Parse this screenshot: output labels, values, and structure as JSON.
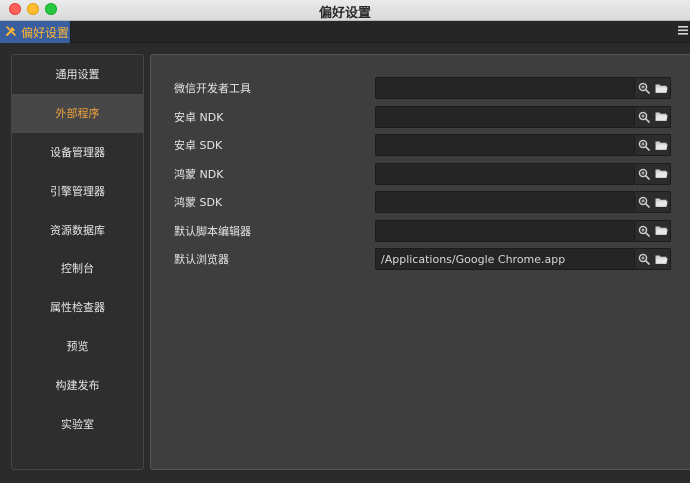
{
  "window": {
    "title": "偏好设置"
  },
  "tab": {
    "icon": "tools-icon",
    "label": "偏好设置"
  },
  "sidebar": {
    "items": [
      {
        "label": "通用设置",
        "active": false
      },
      {
        "label": "外部程序",
        "active": true
      },
      {
        "label": "设备管理器",
        "active": false
      },
      {
        "label": "引擎管理器",
        "active": false
      },
      {
        "label": "资源数据库",
        "active": false
      },
      {
        "label": "控制台",
        "active": false
      },
      {
        "label": "属性检查器",
        "active": false
      },
      {
        "label": "预览",
        "active": false
      },
      {
        "label": "构建发布",
        "active": false
      },
      {
        "label": "实验室",
        "active": false
      }
    ]
  },
  "settings": [
    {
      "label": "微信开发者工具",
      "value": ""
    },
    {
      "label": "安卓 NDK",
      "value": ""
    },
    {
      "label": "安卓 SDK",
      "value": ""
    },
    {
      "label": "鸿蒙 NDK",
      "value": ""
    },
    {
      "label": "鸿蒙 SDK",
      "value": ""
    },
    {
      "label": "默认脚本编辑器",
      "value": ""
    },
    {
      "label": "默认浏览器",
      "value": "/Applications/Google Chrome.app"
    }
  ],
  "colors": {
    "accent": "#f0a23c",
    "tab_bg": "#3a5fa0"
  }
}
